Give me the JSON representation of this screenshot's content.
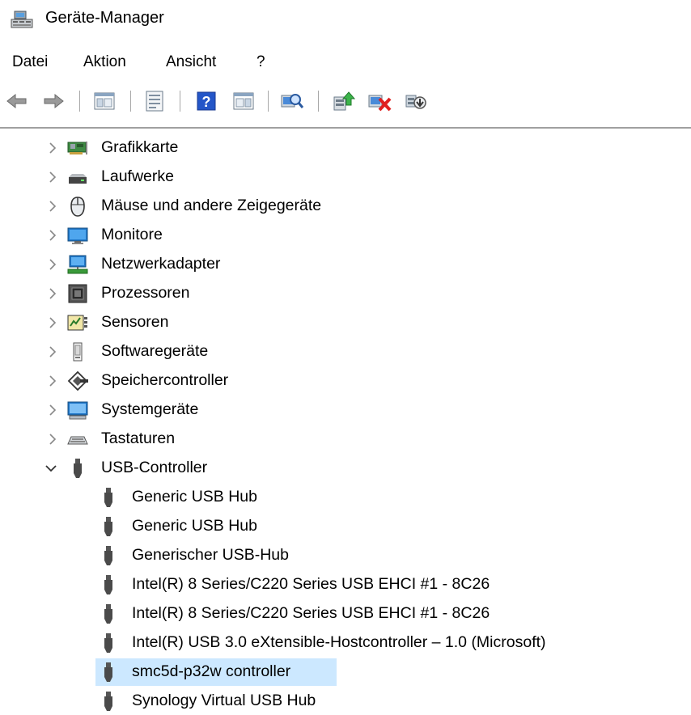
{
  "window": {
    "title": "Geräte-Manager"
  },
  "menu": [
    "Datei",
    "Aktion",
    "Ansicht",
    "?"
  ],
  "toolbar": {
    "buttons": [
      "back-arrow-icon",
      "forward-arrow-icon",
      "show-hide-console-tree-icon",
      "properties-icon",
      "help-icon",
      "action-pane-icon",
      "scan-hardware-changes-icon",
      "update-driver-icon",
      "uninstall-device-icon",
      "disable-device-icon"
    ]
  },
  "tree": {
    "categories": [
      {
        "label": "Grafikkarte",
        "icon": "display-adapter-icon",
        "expanded": false
      },
      {
        "label": "Laufwerke",
        "icon": "disk-drive-icon",
        "expanded": false
      },
      {
        "label": "Mäuse und andere Zeigegeräte",
        "icon": "mouse-icon",
        "expanded": false
      },
      {
        "label": "Monitore",
        "icon": "monitor-icon",
        "expanded": false
      },
      {
        "label": "Netzwerkadapter",
        "icon": "network-adapter-icon",
        "expanded": false
      },
      {
        "label": "Prozessoren",
        "icon": "processor-icon",
        "expanded": false
      },
      {
        "label": "Sensoren",
        "icon": "sensor-icon",
        "expanded": false
      },
      {
        "label": "Softwaregeräte",
        "icon": "software-device-icon",
        "expanded": false
      },
      {
        "label": "Speichercontroller",
        "icon": "storage-controller-icon",
        "expanded": false
      },
      {
        "label": "Systemgeräte",
        "icon": "system-device-icon",
        "expanded": false
      },
      {
        "label": "Tastaturen",
        "icon": "keyboard-icon",
        "expanded": false
      },
      {
        "label": "USB-Controller",
        "icon": "usb-icon",
        "expanded": true
      }
    ],
    "usb_devices": [
      {
        "label": "Generic USB Hub",
        "selected": false
      },
      {
        "label": "Generic USB Hub",
        "selected": false
      },
      {
        "label": "Generischer USB-Hub",
        "selected": false
      },
      {
        "label": "Intel(R) 8 Series/C220 Series USB EHCI #1 - 8C26",
        "selected": false
      },
      {
        "label": "Intel(R) 8 Series/C220 Series USB EHCI #1 - 8C26",
        "selected": false
      },
      {
        "label": "Intel(R) USB 3.0 eXtensible-Hostcontroller – 1.0 (Microsoft)",
        "selected": false
      },
      {
        "label": "smc5d-p32w controller",
        "selected": true
      },
      {
        "label": "Synology Virtual USB Hub",
        "selected": false
      }
    ]
  },
  "colors": {
    "selection": "#cce8ff",
    "accent": "#0078d7"
  }
}
